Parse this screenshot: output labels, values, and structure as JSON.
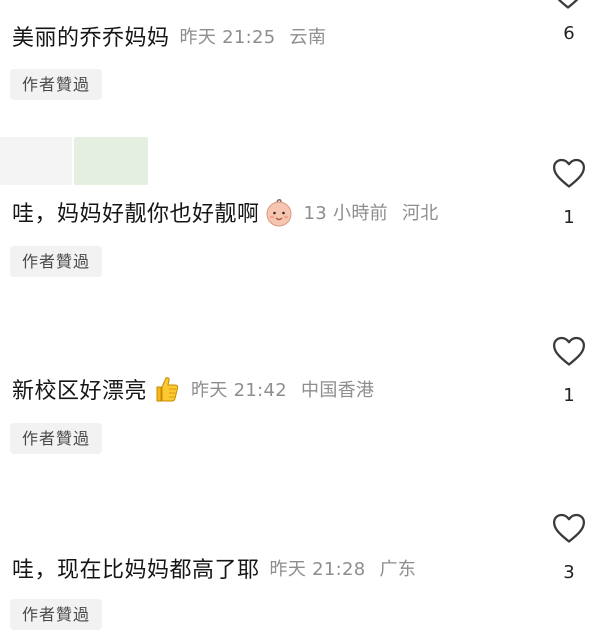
{
  "comments": [
    {
      "text": "美丽的乔乔妈妈",
      "time": "昨天 21:25",
      "location": "云南",
      "likes": "6",
      "badge": "作者贊過",
      "emoji": null
    },
    {
      "text": "哇，妈妈好靓你也好靓啊",
      "time": "13 小時前",
      "location": "河北",
      "likes": "1",
      "badge": "作者贊過",
      "emoji": "baby-face-emoji"
    },
    {
      "text": "新校区好漂亮",
      "time": "昨天 21:42",
      "location": "中国香港",
      "likes": "1",
      "badge": "作者贊過",
      "emoji": "thumbs-up-emoji"
    },
    {
      "text": "哇，现在比妈妈都高了耶",
      "time": "昨天 21:28",
      "location": "广东",
      "likes": "3",
      "badge": "作者贊過",
      "emoji": null
    }
  ],
  "colors": {
    "meta": "#8e8e8e",
    "badge_bg": "#f2f2f2",
    "text": "#161616"
  }
}
